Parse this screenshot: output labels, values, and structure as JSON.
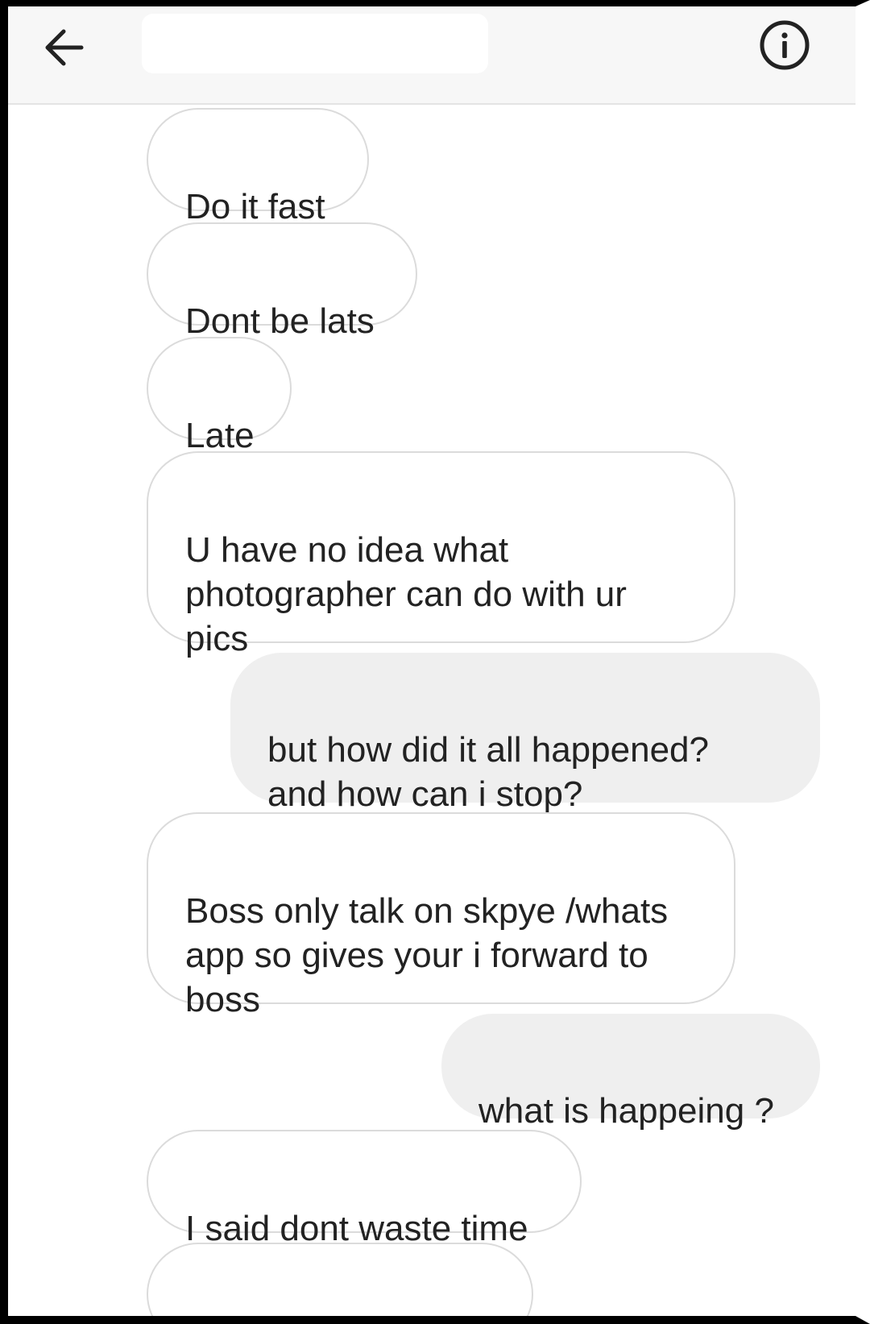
{
  "header": {
    "back_icon": "arrow-left-icon",
    "title": "",
    "info_icon": "info-circle-icon"
  },
  "messages": [
    {
      "direction": "incoming",
      "text": "Do it fast"
    },
    {
      "direction": "incoming",
      "text": "Dont be lats"
    },
    {
      "direction": "incoming",
      "text": "Late"
    },
    {
      "direction": "incoming",
      "text": "U have no idea what\nphotographer can do with ur\npics"
    },
    {
      "direction": "outgoing",
      "text": "but how did it all happened?\nand how can i stop?"
    },
    {
      "direction": "incoming",
      "text": "Boss only talk on skpye /whats\napp so gives your i forward to\nboss"
    },
    {
      "direction": "outgoing",
      "text": "what is happeing ?"
    },
    {
      "direction": "incoming",
      "text": "I said dont waste time"
    }
  ],
  "colors": {
    "incoming_bubble": "#ffffff",
    "incoming_border": "#dbdbdb",
    "outgoing_bubble": "#efefef",
    "text": "#222222",
    "header_bg": "#f7f7f7"
  }
}
